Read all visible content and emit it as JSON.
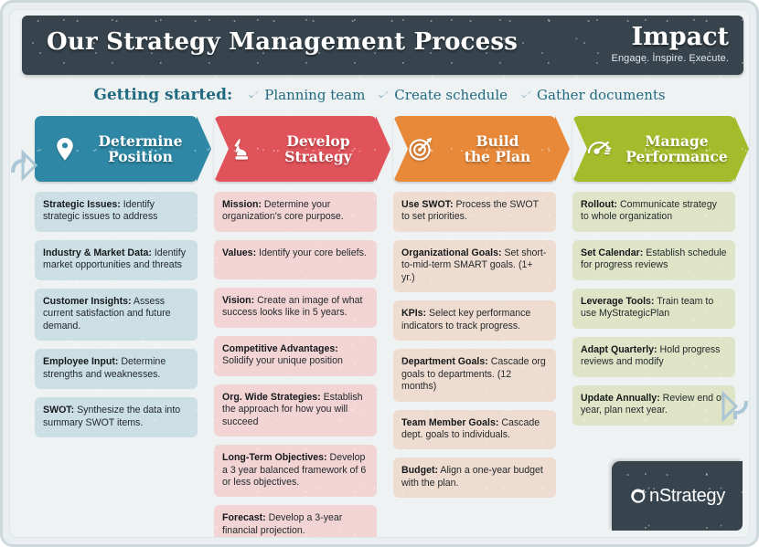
{
  "masthead": {
    "title": "Our Strategy Management Process",
    "brand_name": "Impact",
    "brand_tagline": "Engage. Inspire. Execute.",
    "background_color": "#37444d"
  },
  "getting_started": {
    "label": "Getting started:",
    "accent_color": "#1f6a80",
    "items": [
      {
        "icon": "check-icon",
        "label": "Planning team"
      },
      {
        "icon": "check-icon",
        "label": "Create schedule"
      },
      {
        "icon": "check-icon",
        "label": "Gather documents"
      }
    ]
  },
  "columns": [
    {
      "icon": "map-pin-icon",
      "title_line1": "Determine",
      "title_line2": "Position",
      "header_color": "#2e87a4",
      "card_color": "#cbdfe4",
      "cards": [
        {
          "term": "Strategic Issues:",
          "text": " Identify strategic issues to address"
        },
        {
          "term": "Industry & Market Data:",
          "text": " Identify market opportunities and threats"
        },
        {
          "term": "Customer Insights:",
          "text": " Assess current satisfaction and future demand."
        },
        {
          "term": "Employee Input:",
          "text": " Determine strengths and weaknesses."
        },
        {
          "term": "SWOT:",
          "text": " Synthesize the data into summary SWOT items."
        }
      ]
    },
    {
      "icon": "chess-knight-icon",
      "title_line1": "Develop",
      "title_line2": "Strategy",
      "header_color": "#e1535a",
      "card_color": "#f2d4d5",
      "cards": [
        {
          "term": "Mission:",
          "text": " Determine your organization's core purpose."
        },
        {
          "term": "Values:",
          "text": " Identify your core beliefs."
        },
        {
          "term": "Vision:",
          "text": " Create an image of what success looks like in 5 years."
        },
        {
          "term": "Competitive Advantages:",
          "text": " Solidify your unique position"
        },
        {
          "term": "Org. Wide Strategies:",
          "text": " Establish the approach for how you will succeed"
        },
        {
          "term": "Long-Term Objectives:",
          "text": " Develop a 3 year balanced framework of 6 or less objectives."
        },
        {
          "term": "Forecast:",
          "text": " Develop a 3-year financial projection."
        }
      ]
    },
    {
      "icon": "target-arrow-icon",
      "title_line1": "Build",
      "title_line2": "the Plan",
      "header_color": "#e8893a",
      "card_color": "#efdcd0",
      "cards": [
        {
          "term": "Use SWOT:",
          "text": " Process the SWOT to set priorities."
        },
        {
          "term": "Organizational Goals:",
          "text": " Set short-to-mid-term SMART goals. (1+ yr.)"
        },
        {
          "term": "KPIs:",
          "text": " Select key performance indicators to track progress."
        },
        {
          "term": "Department Goals:",
          "text": " Cascade org goals to departments. (12 months)"
        },
        {
          "term": "Team Member Goals:",
          "text": " Cascade dept. goals to individuals."
        },
        {
          "term": "Budget:",
          "text": " Align a one-year budget with the plan."
        }
      ]
    },
    {
      "icon": "speedometer-icon",
      "title_line1": "Manage",
      "title_line2": "Performance",
      "header_color": "#a4bc2c",
      "card_color": "#dfe4c6",
      "cards": [
        {
          "term": "Rollout:",
          "text": " Communicate strategy to whole organization"
        },
        {
          "term": "Set Calendar:",
          "text": " Establish schedule for progress reviews"
        },
        {
          "term": "Leverage Tools:",
          "text": " Train team to use MyStrategicPlan"
        },
        {
          "term": "Adapt Quarterly:",
          "text": " Hold progress reviews and modify"
        },
        {
          "term": "Update Annually:",
          "text": " Review end of year, plan next year."
        }
      ]
    }
  ],
  "flow_arrows": {
    "left": "cycle-arrow-left-icon",
    "right": "cycle-arrow-right-icon",
    "color": "#a8c4d4"
  },
  "footer": {
    "logo_text": "nStrategy",
    "logo_mark": "o-swirl-icon",
    "plate_color": "#37444d"
  }
}
